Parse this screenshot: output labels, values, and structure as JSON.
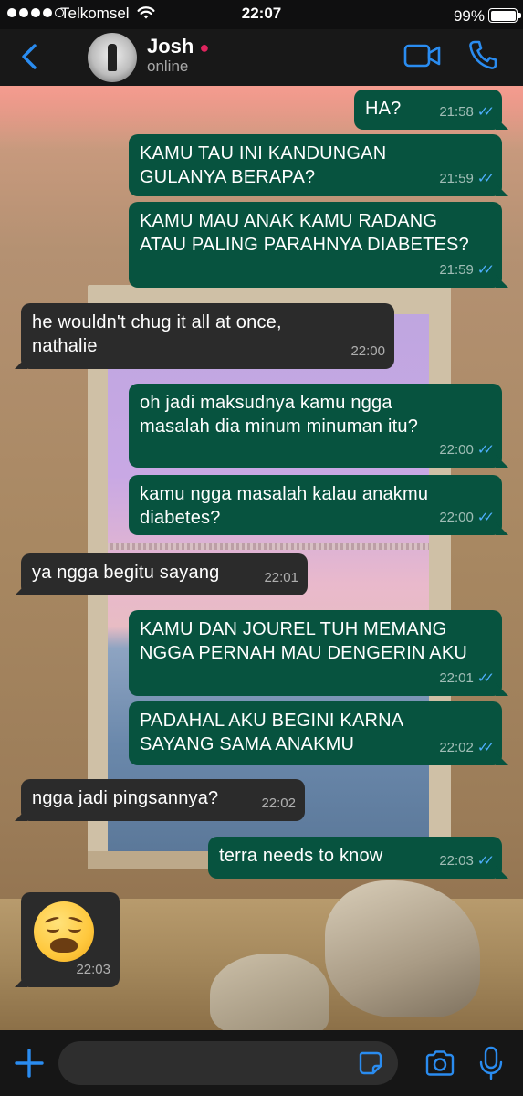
{
  "status_bar": {
    "carrier": "Telkomsel",
    "time": "22:07",
    "battery": "99%",
    "signal_bars": 4,
    "signal_total": 5
  },
  "header": {
    "contact_name": "Josh",
    "contact_status": "online",
    "icons": [
      "back-chevron-icon",
      "video-call-icon",
      "phone-icon"
    ]
  },
  "messages": [
    {
      "dir": "out",
      "text": "HA?",
      "time": "21:58",
      "ticks": "✓✓"
    },
    {
      "dir": "out",
      "text": "KAMU TAU INI KANDUNGAN\nGULANYA BERAPA?",
      "time": "21:59",
      "ticks": "✓✓"
    },
    {
      "dir": "out",
      "text": "KAMU MAU ANAK KAMU RADANG\nATAU PALING PARAHNYA DIABETES?",
      "time": "21:59",
      "ticks": "✓✓"
    },
    {
      "dir": "in",
      "text": "he wouldn't chug it all at once,\nnathalie",
      "time": "22:00"
    },
    {
      "dir": "out",
      "text": "oh jadi maksudnya kamu ngga\nmasalah dia minum minuman itu?",
      "time": "22:00",
      "ticks": "✓✓"
    },
    {
      "dir": "out",
      "text": "kamu ngga masalah kalau anakmu\ndiabetes?",
      "time": "22:00",
      "ticks": "✓✓"
    },
    {
      "dir": "in",
      "text": "ya ngga begitu sayang",
      "time": "22:01"
    },
    {
      "dir": "out",
      "text": "KAMU DAN JOUREL TUH MEMANG\nNGGA PERNAH MAU DENGERIN AKU",
      "time": "22:01",
      "ticks": "✓✓"
    },
    {
      "dir": "out",
      "text": "PADAHAL AKU BEGINI KARNA\nSAYANG SAMA ANAKMU",
      "time": "22:02",
      "ticks": "✓✓"
    },
    {
      "dir": "in",
      "text": "ngga jadi pingsannya?",
      "time": "22:02"
    },
    {
      "dir": "out",
      "text": "terra needs to know",
      "time": "22:03",
      "ticks": "✓✓"
    },
    {
      "dir": "in",
      "emoji": "weary-face",
      "time": "22:03"
    }
  ],
  "composer": {
    "placeholder": "",
    "icons": [
      "plus-icon",
      "sticker-icon",
      "camera-icon",
      "microphone-icon"
    ]
  },
  "colors": {
    "outgoing_bubble": "#07533f",
    "incoming_bubble": "#2b2b2b",
    "accent_blue": "#2a8cf0",
    "read_tick": "#4fb0ff"
  }
}
